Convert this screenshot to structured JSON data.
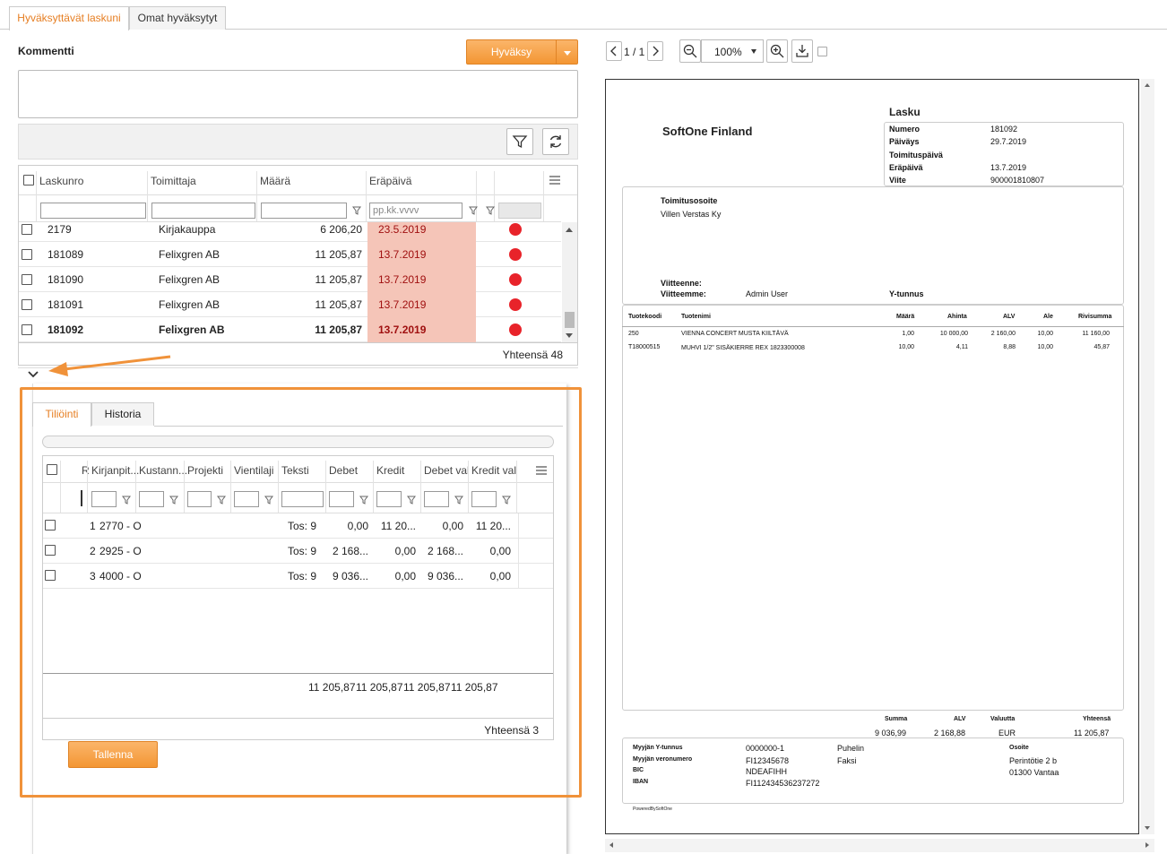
{
  "tabs": [
    {
      "label": "Hyväksyttävät laskuni"
    },
    {
      "label": "Omat hyväksytyt"
    }
  ],
  "comment": {
    "label": "Kommentti",
    "value": ""
  },
  "approve": {
    "label": "Hyväksy"
  },
  "invoice_grid": {
    "headers": [
      "Laskunro",
      "Toimittaja",
      "Määrä",
      "Eräpäivä"
    ],
    "date_placeholder": "pp.kk.vvvv",
    "rows": [
      {
        "no": "2179",
        "supplier": "Kirjakauppa",
        "amount": "6 206,20",
        "due": "23.5.2019",
        "bold": false
      },
      {
        "no": "181089",
        "supplier": "Felixgren AB",
        "amount": "11 205,87",
        "due": "13.7.2019",
        "bold": false
      },
      {
        "no": "181090",
        "supplier": "Felixgren AB",
        "amount": "11 205,87",
        "due": "13.7.2019",
        "bold": false
      },
      {
        "no": "181091",
        "supplier": "Felixgren AB",
        "amount": "11 205,87",
        "due": "13.7.2019",
        "bold": false
      },
      {
        "no": "181092",
        "supplier": "Felixgren AB",
        "amount": "11 205,87",
        "due": "13.7.2019",
        "bold": true
      }
    ],
    "total": "Yhteensä 48",
    "status_color": "#e8232a",
    "due_bg": "#f5c5b8"
  },
  "sub_tabs": [
    {
      "label": "Tiliöinti"
    },
    {
      "label": "Historia"
    }
  ],
  "acc_grid": {
    "headers": [
      "R",
      "Kirjanpit...",
      "Kustann...",
      "Projekti",
      "Vientilaji",
      "Teksti",
      "Debet",
      "Kredit",
      "Debet val",
      "Kredit val"
    ],
    "rows": [
      {
        "n": "1",
        "account": "2770 - O",
        "text": "Tos: 9",
        "debet": "0,00",
        "kredit": "11 20...",
        "debet_val": "0,00",
        "kredit_val": "11 20..."
      },
      {
        "n": "2",
        "account": "2925 - O",
        "text": "Tos: 9",
        "debet": "2 168...",
        "kredit": "0,00",
        "debet_val": "2 168...",
        "kredit_val": "0,00"
      },
      {
        "n": "3",
        "account": "4000 - O",
        "text": "Tos: 9",
        "debet": "9 036...",
        "kredit": "0,00",
        "debet_val": "9 036...",
        "kredit_val": "0,00"
      }
    ],
    "sums": [
      "11 205,87",
      "11 205,87",
      "11 205,87",
      "11 205,87"
    ],
    "total": "Yhteensä 3"
  },
  "save": {
    "label": "Tallenna"
  },
  "viewer": {
    "page": "1 / 1",
    "zoom": "100%"
  },
  "invoice_doc": {
    "company": "SoftOne Finland",
    "doc_title": "Lasku",
    "meta": [
      {
        "k": "Numero",
        "v": "181092"
      },
      {
        "k": "Päiväys",
        "v": "29.7.2019"
      },
      {
        "k": "Toimituspäivä",
        "v": ""
      },
      {
        "k": "Eräpäivä",
        "v": "13.7.2019"
      },
      {
        "k": "Viite",
        "v": "900001810807"
      }
    ],
    "delivery_label": "Toimitusosoite",
    "delivery_name": "Villen Verstas Ky",
    "our_ref_label": "Viitteenne:",
    "their_ref_label": "Viitteemme:",
    "their_ref_value": "Admin User",
    "ytunnus_label": "Y-tunnus",
    "line_headers": [
      "Tuotekoodi",
      "Tuotenimi",
      "Määrä",
      "Ahinta",
      "ALV",
      "Ale",
      "Rivisumma"
    ],
    "lines": [
      {
        "code": "250",
        "name": "VIENNA CONCERT MUSTA KIILTÄVÄ",
        "qty": "1,00",
        "price": "10 000,00",
        "vat": "2 160,00",
        "disc": "10,00",
        "sum": "11 160,00"
      },
      {
        "code": "T18000515",
        "name": "MUHVI 1/2\" SISÄKIERRE REX 1823300008",
        "qty": "10,00",
        "price": "4,11",
        "vat": "8,88",
        "disc": "10,00",
        "sum": "45,87"
      }
    ],
    "summary_headers": [
      "Summa",
      "ALV",
      "Valuutta",
      "Yhteensä"
    ],
    "summary_values": [
      "9 036,99",
      "2 168,88",
      "EUR",
      "11 205,87"
    ],
    "seller": [
      {
        "k": "Myyjän Y-tunnus",
        "v": "0000000-1"
      },
      {
        "k": "Myyjän veronumero",
        "v": "FI12345678"
      },
      {
        "k": "BIC",
        "v": "NDEAFIHH"
      },
      {
        "k": "IBAN",
        "v": "FI112434536237272"
      }
    ],
    "phone_label": "Puhelin",
    "fax_label": "Faksi",
    "address_label": "Osoite",
    "address_1": "Perintötie 2 b",
    "address_2": "01300 Vantaa",
    "powered": "PoweredBySoftOne"
  }
}
